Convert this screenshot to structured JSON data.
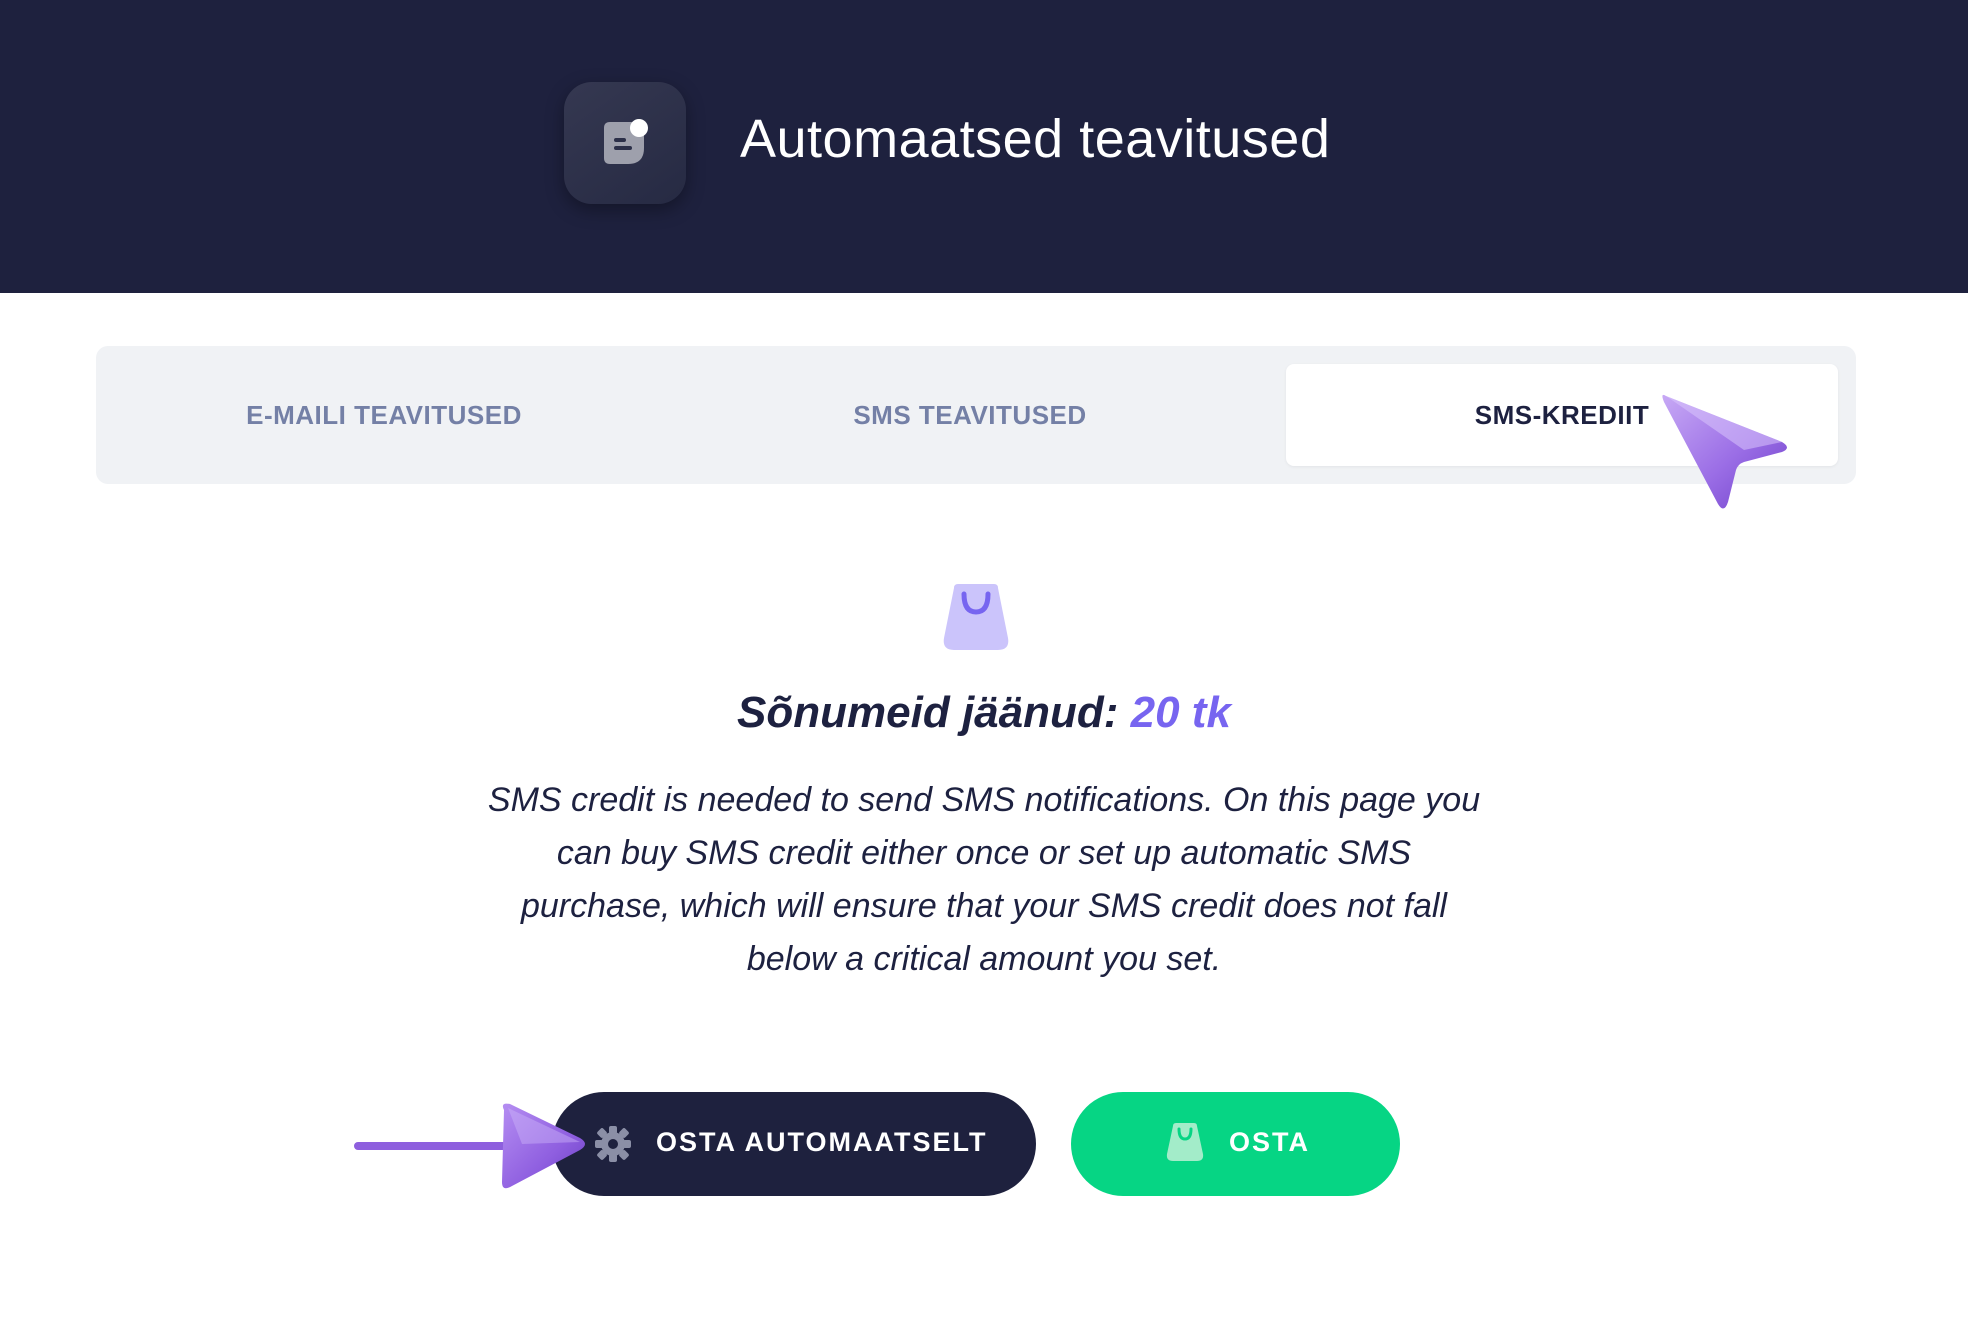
{
  "header": {
    "app_icon": "chat-bubble-notification-icon",
    "title": "Automaatsed teavitused"
  },
  "tabs": [
    {
      "label": "E-MAILI TEAVITUSED",
      "active": false
    },
    {
      "label": "SMS TEAVITUSED",
      "active": false
    },
    {
      "label": "SMS-KREDIIT",
      "active": true
    }
  ],
  "credit": {
    "icon": "shopping-bag-icon",
    "label": "Sõnumeid jäänud:",
    "value": "20 tk",
    "description": "SMS credit is needed to send SMS notifications. On this page you can buy SMS credit either once or set up automatic SMS purchase, which will ensure that your SMS credit does not fall below a critical amount you set."
  },
  "buttons": {
    "auto_buy": {
      "label": "OSTA AUTOMAATSELT",
      "icon": "gear-icon"
    },
    "buy": {
      "label": "OSTA",
      "icon": "shopping-bag-icon"
    }
  },
  "colors": {
    "header_bg": "#1e213e",
    "accent": "#7765f0",
    "buy_button": "#06d584",
    "text_dark": "#1d2140",
    "tab_inactive": "#7480a6"
  }
}
